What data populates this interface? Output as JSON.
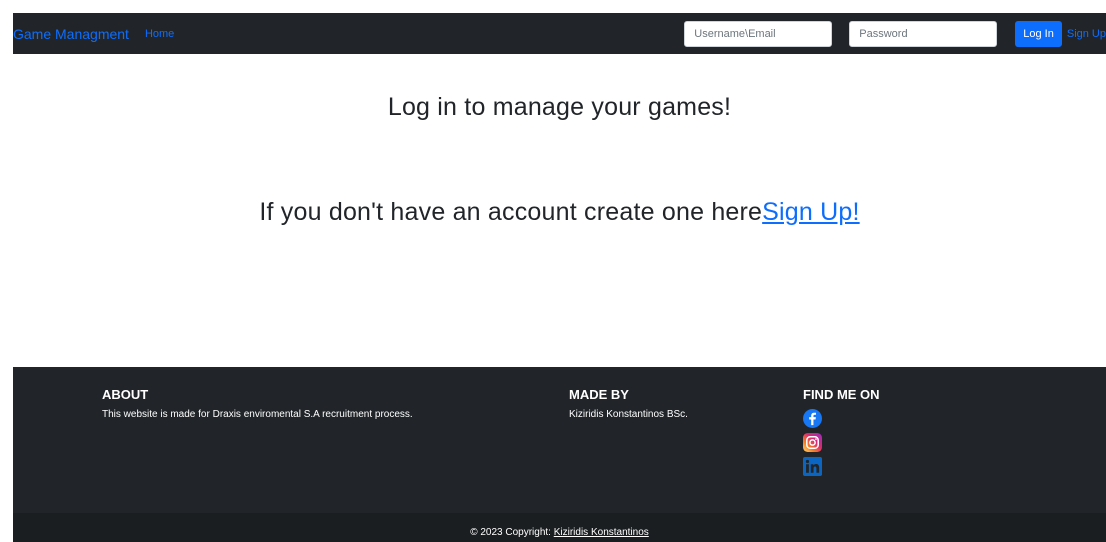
{
  "navbar": {
    "brand": "Game Managment",
    "home": "Home",
    "username_placeholder": "Username\\Email",
    "password_placeholder": "Password",
    "login_label": "Log In",
    "signup_label": "Sign Up"
  },
  "main": {
    "title": "Log in to manage your games!",
    "subtitle": "If you don't have an account create one here",
    "signup_link": "Sign Up!"
  },
  "footer": {
    "about_heading": "ABOUT",
    "about_text": "This website is made for Draxis enviromental S.A recruitment process.",
    "made_by_heading": "MADE BY",
    "made_by_text": "Kiziridis Konstantinos BSc.",
    "find_me_heading": "FIND ME ON",
    "social_icons": [
      "facebook-icon",
      "instagram-icon",
      "linkedin-icon"
    ],
    "copyright_prefix": "© 2023 Copyright: ",
    "copyright_link": "Kiziridis Konstantinos"
  },
  "colors": {
    "accent": "#0d6efd",
    "dark": "#212529",
    "facebook": "#1877f2",
    "linkedin": "#0a66c2"
  }
}
